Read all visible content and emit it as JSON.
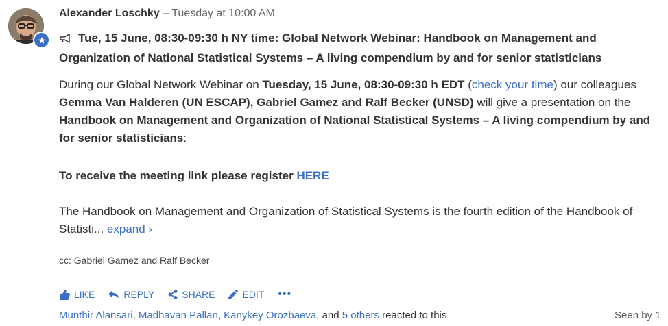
{
  "post": {
    "author": "Alexander Loschky",
    "separator": " – ",
    "timestamp": "Tuesday at 10:00 AM",
    "title": "Tue, 15 June, 08:30-09:30 h NY time: Global Network Webinar: Handbook on Management and Organization of National Statistical Systems – A living compendium by and for senior statisticians"
  },
  "body": {
    "p1": {
      "t1": "During our Global Network Webinar on ",
      "b1": "Tuesday, 15 June, 08:30-09:30 h EDT",
      "t2": " (",
      "link": "check your time",
      "t3": ") our colleagues ",
      "b2": "Gemma Van Halderen (UN ESCAP), Gabriel Gamez and Ralf Becker (UNSD)",
      "t4": " will give a presentation on the ",
      "b3": "Handbook on Management and Organization of National Statistical Systems – A living compendium by and for senior statisticians",
      "t5": ":"
    },
    "register_text": "To receive the meeting link please register ",
    "register_link": "HERE",
    "p2_text": "The Handbook on Management and Organization of Statistical Systems is the fourth edition of the Handbook of Statisti...",
    "expand": "expand ›",
    "cc": "cc: Gabriel Gamez and Ralf Becker"
  },
  "actions": {
    "like": "LIKE",
    "reply": "REPLY",
    "share": "SHARE",
    "edit": "EDIT",
    "more": "•••"
  },
  "reactions": {
    "users": [
      "Munthir Alansari",
      "Madhavan Pallan",
      "Kanykey Orozbaeva"
    ],
    "sep1": ", ",
    "sep2": ", ",
    "sep3": ", and ",
    "others": "5 others",
    "suffix": " reacted to this"
  },
  "seen": "Seen by 1",
  "colors": {
    "link": "#3a6fc4",
    "text": "#333333",
    "muted": "#666666"
  },
  "icons": [
    "verified-star-icon",
    "announcement-icon",
    "thumbs-up-icon",
    "reply-arrow-icon",
    "share-icon",
    "edit-pencil-icon",
    "more-dots-icon"
  ]
}
